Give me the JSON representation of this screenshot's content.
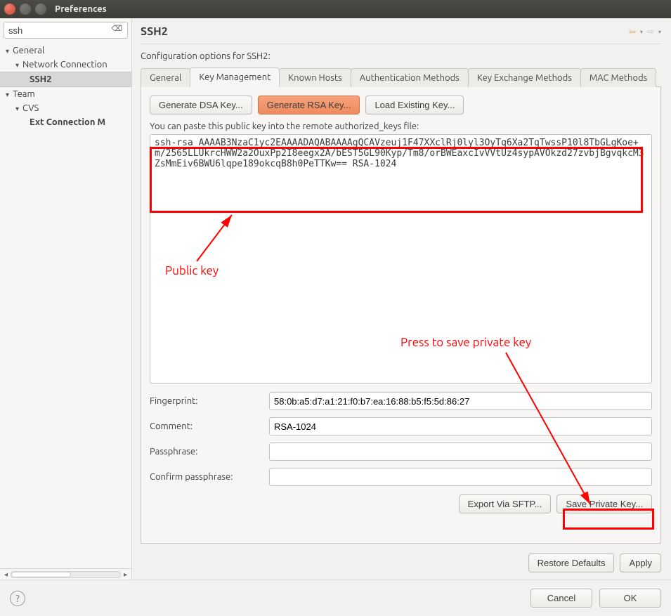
{
  "window": {
    "title": "Preferences"
  },
  "sidebar": {
    "search_value": "ssh",
    "items": [
      {
        "label": "General",
        "expanded": true
      },
      {
        "label": "Network Connection",
        "expanded": true
      },
      {
        "label": "SSH2",
        "expanded": false
      },
      {
        "label": "Team",
        "expanded": true
      },
      {
        "label": "CVS",
        "expanded": true
      },
      {
        "label": "Ext Connection M",
        "expanded": false
      }
    ]
  },
  "header": {
    "title": "SSH2",
    "description": "Configuration options for SSH2:"
  },
  "tabs": {
    "items": [
      "General",
      "Key Management",
      "Known Hosts",
      "Authentication Methods",
      "Key Exchange Methods",
      "MAC Methods"
    ],
    "active": "Key Management"
  },
  "key_buttons": {
    "dsa": "Generate DSA Key...",
    "rsa": "Generate RSA Key...",
    "load": "Load Existing Key..."
  },
  "paste_instruction": "You can paste this public key into the remote authorized_keys file:",
  "public_key": "ssh-rsa AAAAB3NzaC1yc2EAAAADAQABAAAAgQCAVzeuj1F47XXclRj0lyl3OyTq6Xa2TqTwssP10l8TbGLgKoe+m/2565LLUkrcHWW2a2OuxPp2I8eegx2A/bEST5GL90Kyp/Tm8/orBWEaxcIvVVtUz4sypAVOkzd27zvbjBgvqkcM3ZsMmEiv6BWU6lqpe189okcqB8h0PeTTKw== RSA-1024",
  "fields": {
    "fingerprint_label": "Fingerprint:",
    "fingerprint_value": "58:0b:a5:d7:a1:21:f0:b7:ea:16:88:b5:f5:5d:86:27",
    "comment_label": "Comment:",
    "comment_value": "RSA-1024",
    "passphrase_label": "Passphrase:",
    "passphrase_value": "",
    "confirm_label": "Confirm passphrase:",
    "confirm_value": ""
  },
  "key_actions": {
    "export": "Export Via SFTP...",
    "save": "Save Private Key..."
  },
  "bottom_buttons": {
    "restore": "Restore Defaults",
    "apply": "Apply"
  },
  "footer": {
    "cancel": "Cancel",
    "ok": "OK"
  },
  "annotations": {
    "public_key_label": "Public key",
    "save_label": "Press to save private key"
  }
}
